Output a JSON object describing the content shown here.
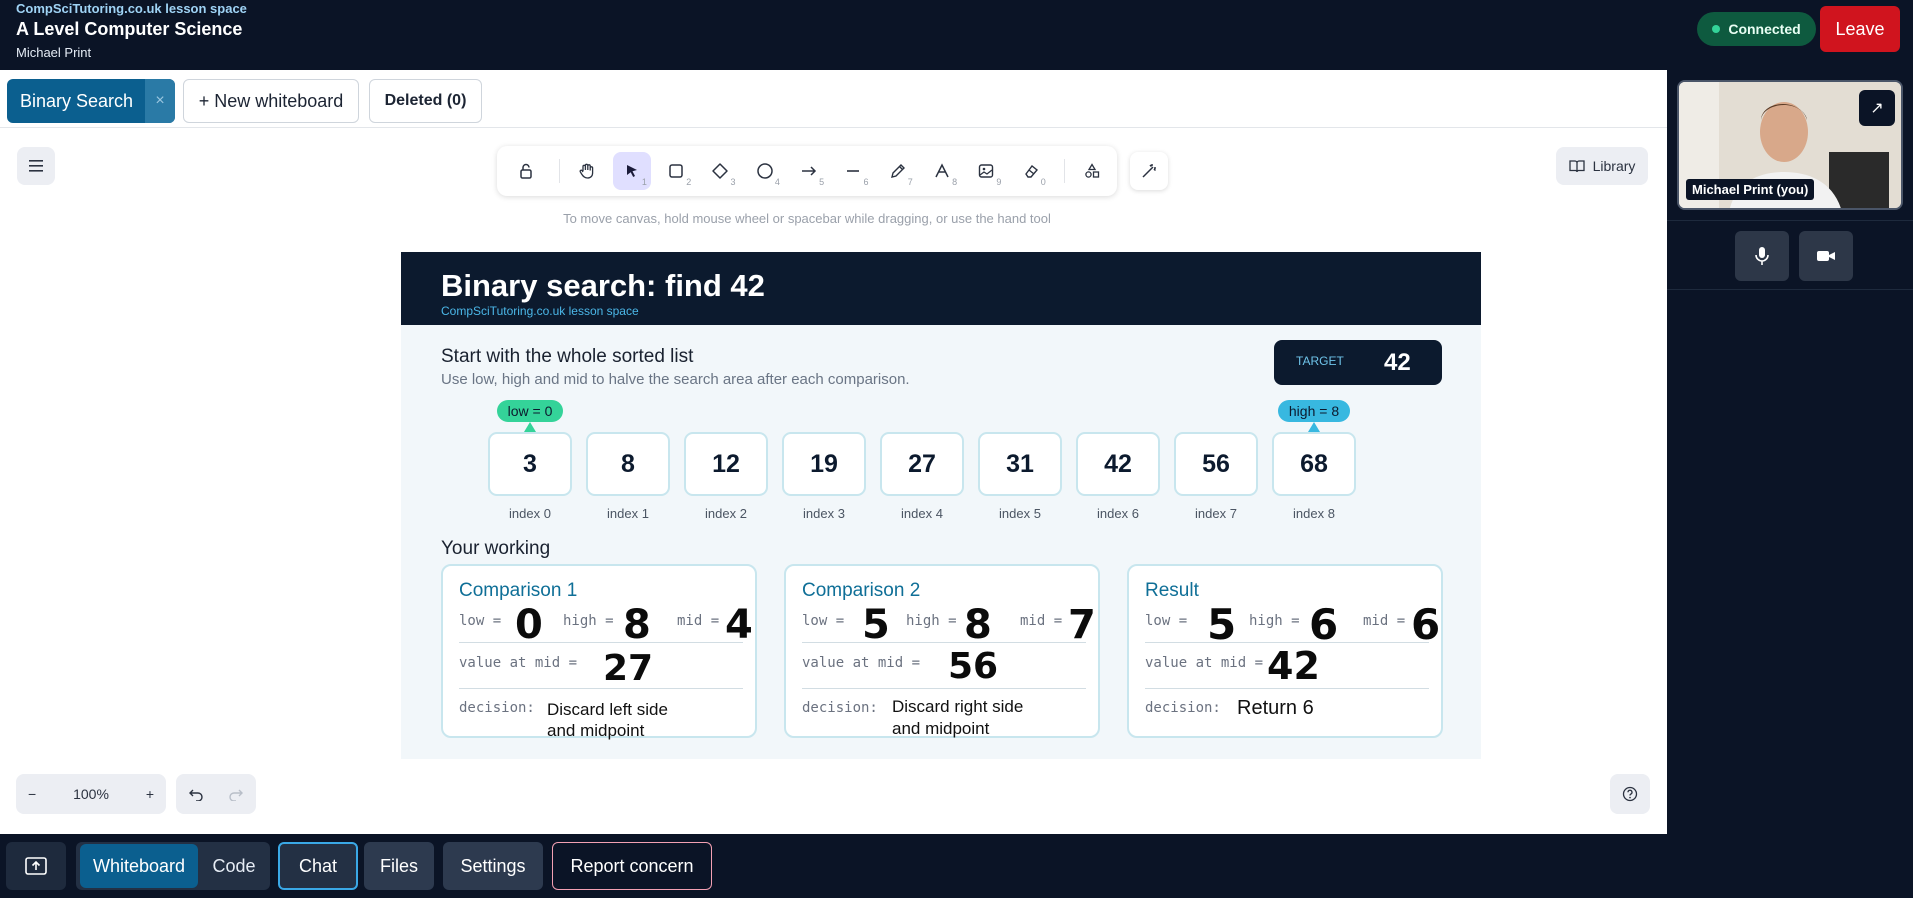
{
  "header": {
    "brand": "CompSciTutoring.co.uk lesson space",
    "course": "A Level Computer Science",
    "user": "Michael Print",
    "status": "Connected",
    "leave_label": "Leave"
  },
  "tabs": {
    "active": "Binary Search",
    "close_glyph": "×",
    "new_whiteboard": "+ New whiteboard",
    "deleted": "Deleted (0)"
  },
  "toolbar": {
    "tools": [
      {
        "icon": "lock-icon",
        "num": ""
      },
      {
        "icon": "hand-icon",
        "num": ""
      },
      {
        "icon": "pointer-icon",
        "num": "1"
      },
      {
        "icon": "rectangle-icon",
        "num": "2"
      },
      {
        "icon": "diamond-icon",
        "num": "3"
      },
      {
        "icon": "ellipse-icon",
        "num": "4"
      },
      {
        "icon": "arrow-icon",
        "num": "5"
      },
      {
        "icon": "line-icon",
        "num": "6"
      },
      {
        "icon": "pencil-icon",
        "num": "7"
      },
      {
        "icon": "text-icon",
        "num": "8"
      },
      {
        "icon": "image-icon",
        "num": "9"
      },
      {
        "icon": "eraser-icon",
        "num": "0"
      },
      {
        "icon": "shapes-icon",
        "num": ""
      }
    ],
    "library_label": "Library",
    "hint": "To move canvas, hold mouse wheel or spacebar while dragging, or use the hand tool"
  },
  "board": {
    "title": "Binary search: find 42",
    "subtitle": "CompSciTutoring.co.uk lesson space",
    "target_label": "TARGET",
    "target_value": "42",
    "section_title": "Start with the whole sorted list",
    "section_desc": "Use low, high and mid to halve the search area after each comparison.",
    "low_pointer": "low = 0",
    "high_pointer": "high = 8",
    "values": [
      "3",
      "8",
      "12",
      "19",
      "27",
      "31",
      "42",
      "56",
      "68"
    ],
    "indices": [
      "index 0",
      "index 1",
      "index 2",
      "index 3",
      "index 4",
      "index 5",
      "index 6",
      "index 7",
      "index 8"
    ],
    "working_title": "Your working",
    "labels": {
      "low": "low =",
      "high": "high =",
      "mid": "mid =",
      "value_at_mid": "value at mid =",
      "decision": "decision:"
    },
    "cards": [
      {
        "title": "Comparison 1",
        "low": "0",
        "high": "8",
        "mid": "4",
        "value": "27",
        "decision_1": "Discard left side",
        "decision_2": "and midpoint"
      },
      {
        "title": "Comparison 2",
        "low": "5",
        "high": "8",
        "mid": "7",
        "value": "56",
        "decision_1": "Discard right side",
        "decision_2": "and midpoint"
      },
      {
        "title": "Result",
        "low": "5",
        "high": "6",
        "mid": "6",
        "value": "42",
        "decision_1": "Return 6",
        "decision_2": ""
      }
    ]
  },
  "canvas_controls": {
    "zoom_out": "−",
    "zoom_level": "100%",
    "zoom_in": "+"
  },
  "video": {
    "name": "Michael Print (you)",
    "expand_glyph": "↗"
  },
  "bottombar": {
    "whiteboard": "Whiteboard",
    "code": "Code",
    "chat": "Chat",
    "files": "Files",
    "settings": "Settings",
    "report": "Report concern"
  },
  "colors": {
    "brand_dark": "#0b1426",
    "accent_blue": "#0b5f8f",
    "leave_red": "#d0141e",
    "connected_green": "#0e5a3f",
    "low_green": "#34d399",
    "high_cyan": "#38b8e0"
  }
}
